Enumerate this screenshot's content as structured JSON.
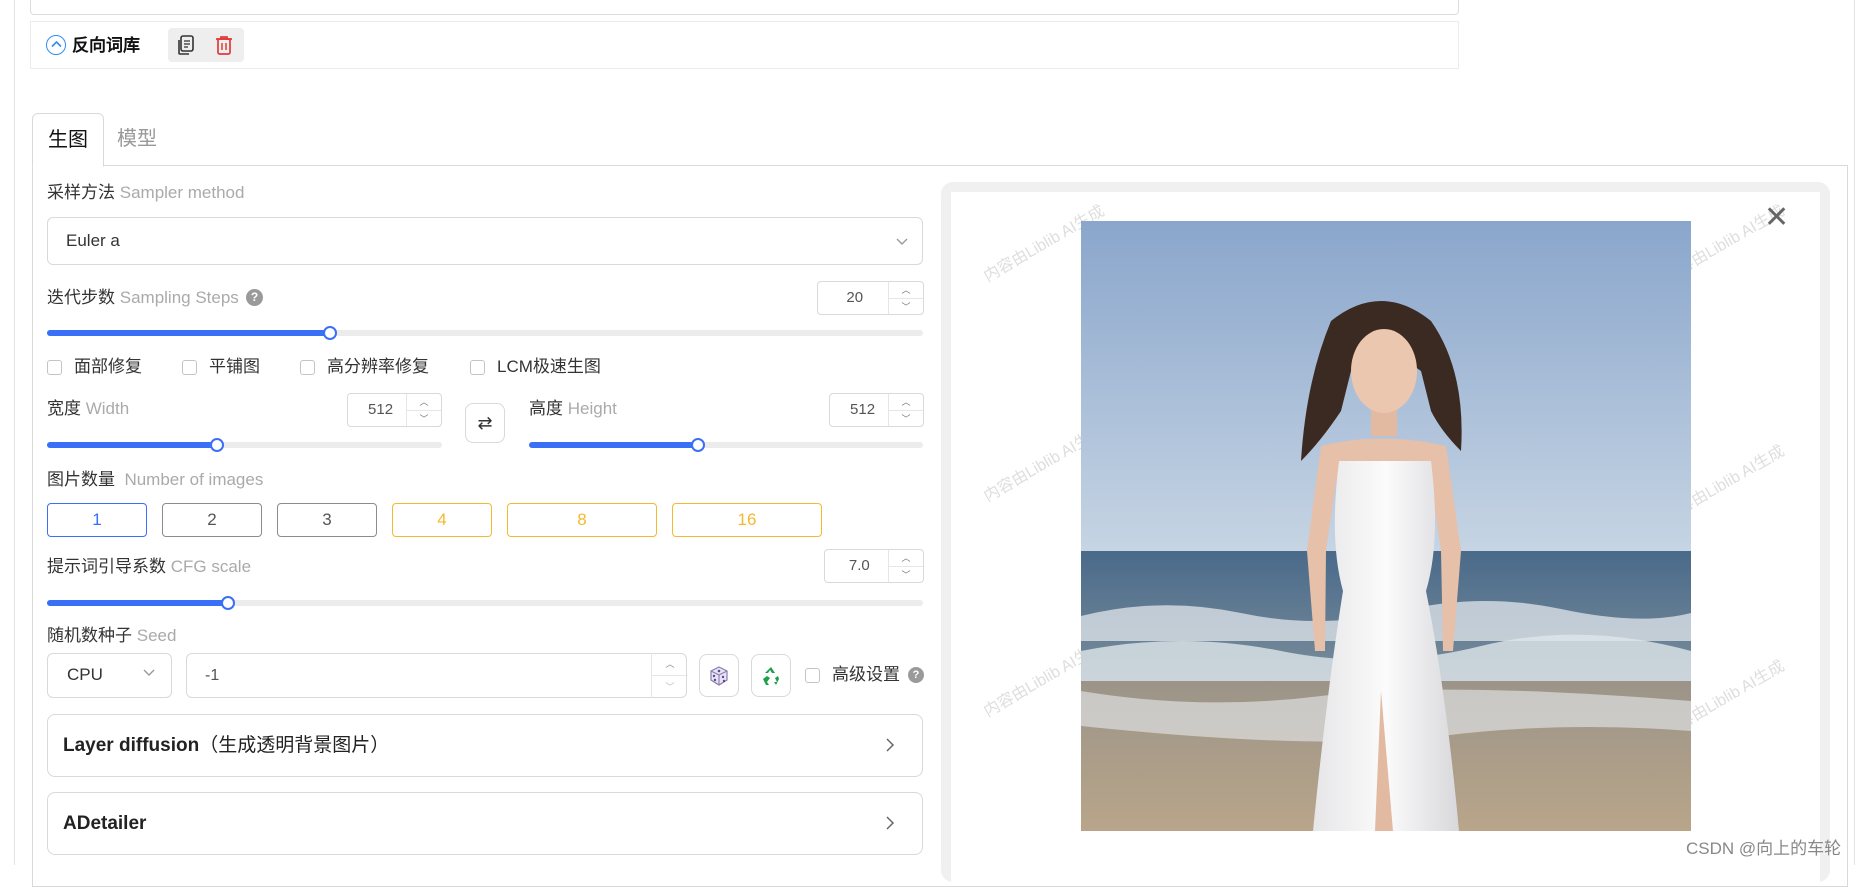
{
  "negative": {
    "label": "反向词库"
  },
  "tabs": [
    {
      "label": "生图"
    },
    {
      "label": "模型"
    }
  ],
  "sampler": {
    "label": "采样方法",
    "label_en": "Sampler method",
    "value": "Euler a"
  },
  "steps": {
    "label": "迭代步数",
    "label_en": "Sampling Steps",
    "value": "20",
    "slider_fraction": 0.323
  },
  "options": [
    {
      "label": "面部修复"
    },
    {
      "label": "平铺图"
    },
    {
      "label": "高分辨率修复"
    },
    {
      "label": "LCM极速生图"
    }
  ],
  "width": {
    "label": "宽度",
    "label_en": "Width",
    "value": "512",
    "slider_fraction": 0.43
  },
  "height": {
    "label": "高度",
    "label_en": "Height",
    "value": "512",
    "slider_fraction": 0.43
  },
  "num_images": {
    "label": "图片数量",
    "label_en": "Number of images",
    "options": [
      "1",
      "2",
      "3",
      "4",
      "8",
      "16"
    ],
    "selected": "1"
  },
  "cfg": {
    "label": "提示词引导系数",
    "label_en": "CFG scale",
    "value": "7.0",
    "slider_fraction": 0.207
  },
  "seed": {
    "label": "随机数种子",
    "label_en": "Seed",
    "device": "CPU",
    "value": "-1",
    "advanced_label": "高级设置"
  },
  "accordions": [
    {
      "title": "Layer diffusion",
      "subtitle": "（生成透明背景图片）"
    },
    {
      "title": "ADetailer",
      "subtitle": ""
    }
  ],
  "preview": {
    "watermark": "内容由Liblib AI生成"
  },
  "footer": {
    "credit": "CSDN @向上的车轮"
  },
  "colors": {
    "accent": "#3a6ff7",
    "warn": "#f5b82e",
    "delete": "#e03a3a",
    "recycle": "#1aa14a"
  }
}
